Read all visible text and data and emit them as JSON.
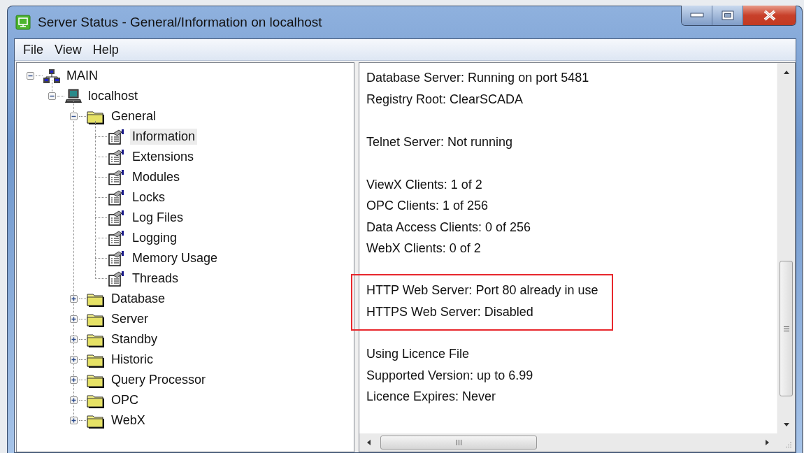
{
  "window": {
    "title": "Server Status - General/Information on localhost"
  },
  "menu": [
    "File",
    "View",
    "Help"
  ],
  "tree": [
    {
      "label": "MAIN",
      "kind": "network",
      "expanded": true,
      "selected": false,
      "children": [
        {
          "label": "localhost",
          "kind": "computer",
          "expanded": true,
          "selected": false,
          "children": [
            {
              "label": "General",
              "kind": "folder",
              "expanded": true,
              "selected": false,
              "children": [
                {
                  "label": "Information",
                  "kind": "page",
                  "selected": true
                },
                {
                  "label": "Extensions",
                  "kind": "page",
                  "selected": false
                },
                {
                  "label": "Modules",
                  "kind": "page",
                  "selected": false
                },
                {
                  "label": "Locks",
                  "kind": "page",
                  "selected": false
                },
                {
                  "label": "Log Files",
                  "kind": "page",
                  "selected": false
                },
                {
                  "label": "Logging",
                  "kind": "page",
                  "selected": false
                },
                {
                  "label": "Memory Usage",
                  "kind": "page",
                  "selected": false
                },
                {
                  "label": "Threads",
                  "kind": "page",
                  "selected": false
                }
              ]
            },
            {
              "label": "Database",
              "kind": "folder",
              "expanded": false,
              "selected": false
            },
            {
              "label": "Server",
              "kind": "folder",
              "expanded": false,
              "selected": false
            },
            {
              "label": "Standby",
              "kind": "folder",
              "expanded": false,
              "selected": false
            },
            {
              "label": "Historic",
              "kind": "folder",
              "expanded": false,
              "selected": false
            },
            {
              "label": "Query Processor",
              "kind": "folder",
              "expanded": false,
              "selected": false
            },
            {
              "label": "OPC",
              "kind": "folder",
              "expanded": false,
              "selected": false
            },
            {
              "label": "WebX",
              "kind": "folder",
              "expanded": false,
              "selected": false
            }
          ]
        }
      ]
    }
  ],
  "info_groups": [
    {
      "highlighted": false,
      "lines": [
        "Database Server: Running on port 5481",
        "Registry Root: ClearSCADA"
      ]
    },
    {
      "highlighted": false,
      "lines": [
        "Telnet Server: Not running"
      ]
    },
    {
      "highlighted": false,
      "lines": [
        "ViewX Clients: 1 of 2",
        "OPC Clients: 1 of 256",
        "Data Access Clients: 0 of 256",
        "WebX Clients: 0 of 2"
      ]
    },
    {
      "highlighted": true,
      "lines": [
        "HTTP Web Server: Port 80 already in use",
        "HTTPS Web Server: Disabled"
      ]
    },
    {
      "highlighted": false,
      "lines": [
        "Using Licence File",
        "Supported Version: up to 6.99",
        "Licence Expires: Never"
      ]
    }
  ]
}
